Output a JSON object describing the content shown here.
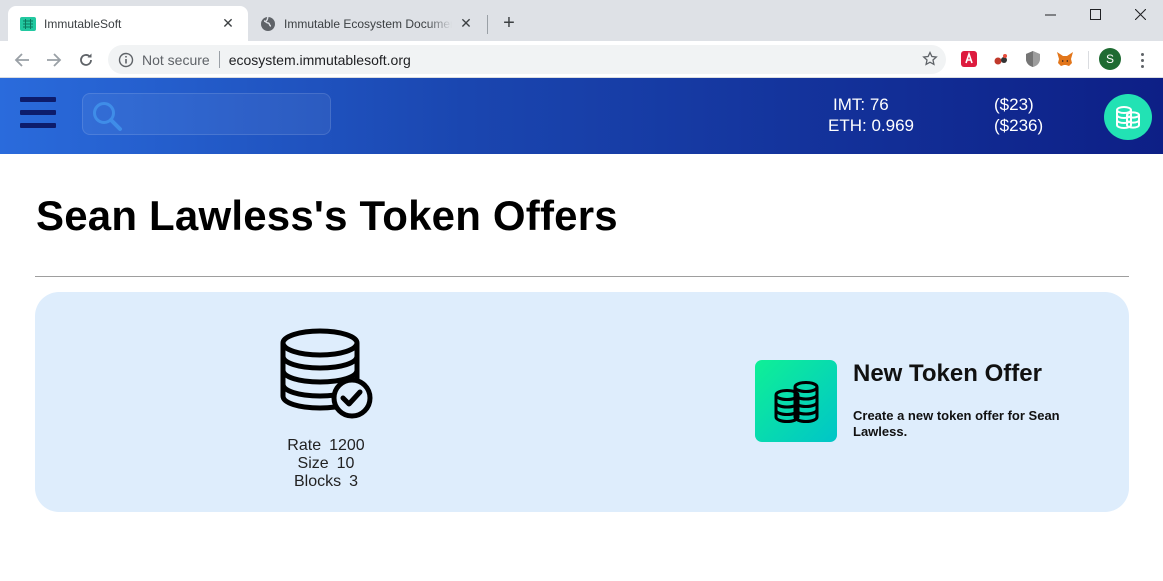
{
  "browser": {
    "tabs": [
      {
        "title": "ImmutableSoft",
        "active": true
      },
      {
        "title": "Immutable Ecosystem Documentation",
        "active": false
      }
    ],
    "omnibox": {
      "security_label": "Not secure",
      "url": "ecosystem.immutablesoft.org"
    },
    "profile_initial": "S",
    "icons": {
      "back": "back-arrow-icon",
      "forward": "forward-arrow-icon",
      "reload": "reload-icon",
      "info": "info-icon",
      "bookmark": "star-icon",
      "menu": "kebab-menu-icon"
    }
  },
  "header": {
    "search_placeholder": "",
    "balances": [
      {
        "label": "IMT: 76",
        "usd": "($23)"
      },
      {
        "label": "ETH: 0.969",
        "usd": "($236)"
      }
    ],
    "colors": {
      "gradient_start": "#2a6bdc",
      "gradient_end": "#0d1f86",
      "avatar": "#22e2b4"
    }
  },
  "main": {
    "title": "Sean Lawless's Token Offers",
    "offer": {
      "stats": [
        {
          "label": "Rate",
          "value": "1200"
        },
        {
          "label": "Size",
          "value": "10"
        },
        {
          "label": "Blocks",
          "value": "3"
        }
      ]
    },
    "new_offer": {
      "title": "New Token Offer",
      "description": "Create a new token offer for Sean Lawless."
    },
    "colors": {
      "card_bg": "#deedfc",
      "new_offer_gradient_start": "#0ff096",
      "new_offer_gradient_end": "#00c5c8"
    }
  }
}
